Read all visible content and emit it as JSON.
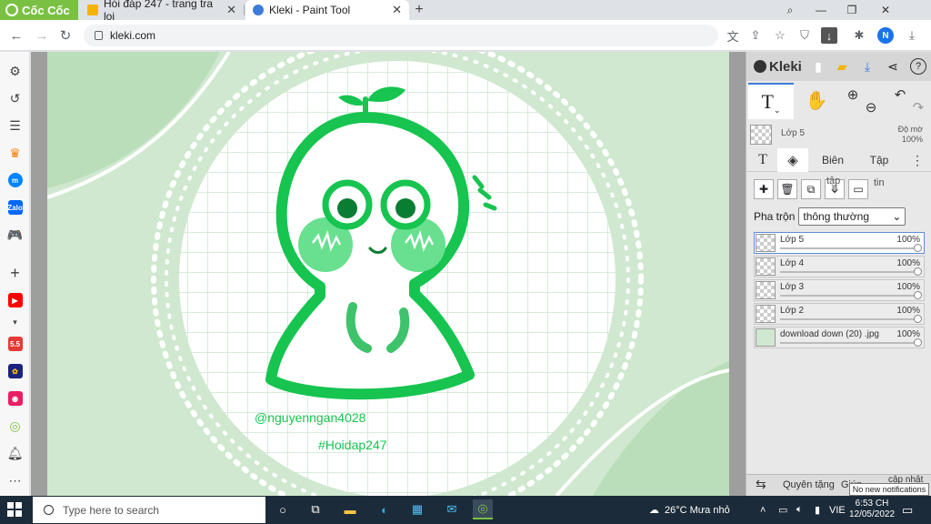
{
  "browser": {
    "brand": "Cốc Cốc",
    "tabs": [
      {
        "label": "Hỏi đáp 247 - trang tra loi",
        "active": false
      },
      {
        "label": "Kleki - Paint Tool",
        "active": true
      }
    ],
    "url": "kleki.com",
    "profile_initial": "N"
  },
  "colors": {
    "brand": "#7ac143",
    "canvas_bg": "#cfe8cf",
    "character": "#16c44f",
    "accent_blue": "#3d7bd9"
  },
  "artwork": {
    "watermark_user": "@nguyenngan4028",
    "watermark_site": "#Hoidap247"
  },
  "kleki": {
    "logo": "Kleki",
    "current_layer": {
      "name": "Lớp 5",
      "opacity_label": "Độ mờ",
      "opacity": "100%"
    },
    "tabs": [
      "Biên",
      "Tập"
    ],
    "layer_button_captions": [
      "tập",
      "tin"
    ],
    "blend_label": "Pha trộn",
    "blend_value": "thông thường",
    "layers": [
      {
        "name": "Lớp 5",
        "opacity": "100%",
        "selected": true
      },
      {
        "name": "Lớp 4",
        "opacity": "100%",
        "selected": false
      },
      {
        "name": "Lớp 3",
        "opacity": "100%",
        "selected": false
      },
      {
        "name": "Lớp 2",
        "opacity": "100%",
        "selected": false
      },
      {
        "name": "download down (20) .jpg",
        "opacity": "100%",
        "selected": false
      }
    ],
    "footer": {
      "rotate_label": "Quyên tặng",
      "help_label": "Giúp",
      "update_label": "cập nhật"
    }
  },
  "taskbar": {
    "search_placeholder": "Type here to search",
    "weather": "26°C  Mưa nhỏ",
    "language": "VIE",
    "time": "6:53 CH",
    "date": "12/05/2022",
    "notification_tip": "No new notifications"
  }
}
